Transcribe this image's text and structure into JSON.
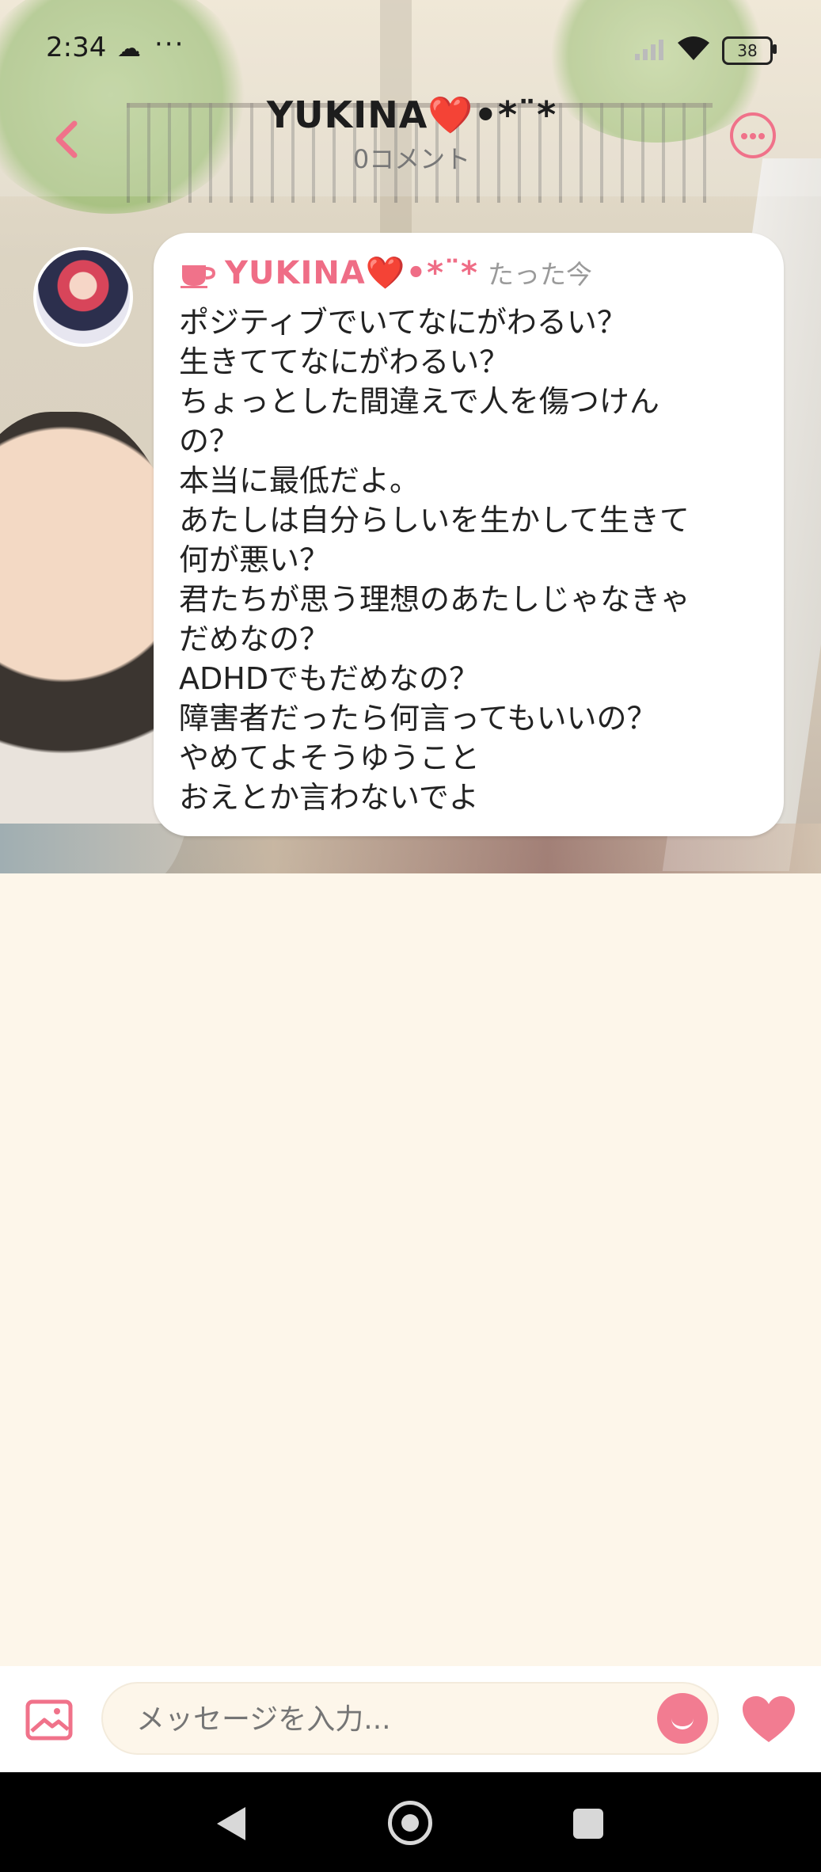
{
  "status_bar": {
    "time": "2:34",
    "battery": "38"
  },
  "header": {
    "title": "YUKINA❤️•*¨*",
    "comment_count": "0コメント"
  },
  "message": {
    "author": "YUKINA❤️•*¨*",
    "timestamp": "たった今",
    "lines": [
      "ポジティブでいてなにがわるい？",
      "生きててなにがわるい？",
      "ちょっとした間違えで人を傷つけん",
      "の？",
      "本当に最低だよ。",
      "あたしは自分らしいを生かして生きて",
      "何が悪い？",
      "君たちが思う理想のあたしじゃなきゃ",
      "だめなの？",
      "ADHDでもだめなの？",
      "障害者だったら何言ってもいいの？",
      "やめてよそうゆうこと",
      "おえとか言わないでよ"
    ]
  },
  "input": {
    "placeholder": "メッセージを入力..."
  },
  "colors": {
    "accent": "#f0728a",
    "background": "#fdf6ea"
  },
  "icons": [
    "cloud-icon",
    "signal-icon",
    "wifi-icon",
    "back-icon",
    "more-icon",
    "cup-icon",
    "image-icon",
    "emoji-icon",
    "heart-icon"
  ]
}
